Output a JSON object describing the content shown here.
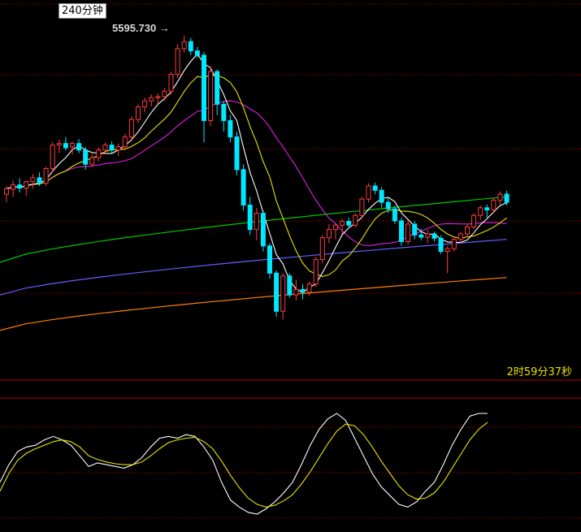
{
  "header": {
    "period_label": "240分钟",
    "peak_price_label": "5595.730",
    "peak_arrow": "→",
    "countdown": "2时59分37秒"
  },
  "colors": {
    "up": "#ff3c3c",
    "down": "#00e8ff",
    "grid": "#b00000",
    "ma5": "#ffffff",
    "ma10": "#e6e600",
    "ma20": "#e020e0",
    "ma60": "#00c800",
    "ma120": "#6060ff",
    "ma250": "#ff8000",
    "k_line": "#ffffff",
    "d_line": "#e6e600"
  },
  "chart_data": [
    {
      "type": "candlestick",
      "title": "",
      "peak": 5595.73,
      "candles": [
        {
          "o": 5305,
          "h": 5320,
          "l": 5290,
          "c": 5315
        },
        {
          "o": 5314,
          "h": 5330,
          "l": 5300,
          "c": 5322
        },
        {
          "o": 5322,
          "h": 5334,
          "l": 5308,
          "c": 5316
        },
        {
          "o": 5316,
          "h": 5330,
          "l": 5302,
          "c": 5328
        },
        {
          "o": 5328,
          "h": 5342,
          "l": 5315,
          "c": 5335
        },
        {
          "o": 5335,
          "h": 5345,
          "l": 5320,
          "c": 5325
        },
        {
          "o": 5325,
          "h": 5355,
          "l": 5320,
          "c": 5352
        },
        {
          "o": 5352,
          "h": 5400,
          "l": 5345,
          "c": 5395
        },
        {
          "o": 5395,
          "h": 5405,
          "l": 5380,
          "c": 5398
        },
        {
          "o": 5398,
          "h": 5410,
          "l": 5385,
          "c": 5390
        },
        {
          "o": 5392,
          "h": 5402,
          "l": 5378,
          "c": 5398
        },
        {
          "o": 5398,
          "h": 5406,
          "l": 5380,
          "c": 5386
        },
        {
          "o": 5386,
          "h": 5392,
          "l": 5350,
          "c": 5360
        },
        {
          "o": 5360,
          "h": 5378,
          "l": 5355,
          "c": 5372
        },
        {
          "o": 5372,
          "h": 5390,
          "l": 5365,
          "c": 5386
        },
        {
          "o": 5386,
          "h": 5400,
          "l": 5378,
          "c": 5395
        },
        {
          "o": 5395,
          "h": 5402,
          "l": 5380,
          "c": 5386
        },
        {
          "o": 5386,
          "h": 5398,
          "l": 5375,
          "c": 5392
        },
        {
          "o": 5392,
          "h": 5416,
          "l": 5386,
          "c": 5410
        },
        {
          "o": 5410,
          "h": 5448,
          "l": 5402,
          "c": 5442
        },
        {
          "o": 5442,
          "h": 5470,
          "l": 5435,
          "c": 5465
        },
        {
          "o": 5465,
          "h": 5482,
          "l": 5455,
          "c": 5476
        },
        {
          "o": 5476,
          "h": 5488,
          "l": 5466,
          "c": 5482
        },
        {
          "o": 5482,
          "h": 5490,
          "l": 5470,
          "c": 5484
        },
        {
          "o": 5484,
          "h": 5500,
          "l": 5476,
          "c": 5494
        },
        {
          "o": 5494,
          "h": 5530,
          "l": 5488,
          "c": 5525
        },
        {
          "o": 5525,
          "h": 5580,
          "l": 5518,
          "c": 5572
        },
        {
          "o": 5572,
          "h": 5596,
          "l": 5565,
          "c": 5585
        },
        {
          "o": 5585,
          "h": 5592,
          "l": 5560,
          "c": 5568
        },
        {
          "o": 5568,
          "h": 5575,
          "l": 5555,
          "c": 5560
        },
        {
          "o": 5560,
          "h": 5566,
          "l": 5400,
          "c": 5440
        },
        {
          "o": 5440,
          "h": 5540,
          "l": 5430,
          "c": 5530
        },
        {
          "o": 5530,
          "h": 5534,
          "l": 5450,
          "c": 5470
        },
        {
          "o": 5470,
          "h": 5476,
          "l": 5420,
          "c": 5440
        },
        {
          "o": 5440,
          "h": 5450,
          "l": 5400,
          "c": 5410
        },
        {
          "o": 5410,
          "h": 5420,
          "l": 5340,
          "c": 5350
        },
        {
          "o": 5350,
          "h": 5360,
          "l": 5275,
          "c": 5285
        },
        {
          "o": 5285,
          "h": 5300,
          "l": 5230,
          "c": 5240
        },
        {
          "o": 5240,
          "h": 5280,
          "l": 5220,
          "c": 5270
        },
        {
          "o": 5270,
          "h": 5275,
          "l": 5200,
          "c": 5210
        },
        {
          "o": 5210,
          "h": 5215,
          "l": 5150,
          "c": 5160
        },
        {
          "o": 5160,
          "h": 5165,
          "l": 5080,
          "c": 5090
        },
        {
          "o": 5090,
          "h": 5160,
          "l": 5075,
          "c": 5155
        },
        {
          "o": 5155,
          "h": 5160,
          "l": 5115,
          "c": 5120
        },
        {
          "o": 5120,
          "h": 5148,
          "l": 5110,
          "c": 5130
        },
        {
          "o": 5130,
          "h": 5140,
          "l": 5112,
          "c": 5125
        },
        {
          "o": 5125,
          "h": 5145,
          "l": 5118,
          "c": 5140
        },
        {
          "o": 5140,
          "h": 5190,
          "l": 5135,
          "c": 5185
        },
        {
          "o": 5185,
          "h": 5230,
          "l": 5178,
          "c": 5225
        },
        {
          "o": 5225,
          "h": 5250,
          "l": 5215,
          "c": 5240
        },
        {
          "o": 5240,
          "h": 5252,
          "l": 5222,
          "c": 5248
        },
        {
          "o": 5248,
          "h": 5260,
          "l": 5232,
          "c": 5255
        },
        {
          "o": 5255,
          "h": 5262,
          "l": 5242,
          "c": 5248
        },
        {
          "o": 5248,
          "h": 5270,
          "l": 5244,
          "c": 5266
        },
        {
          "o": 5266,
          "h": 5300,
          "l": 5260,
          "c": 5296
        },
        {
          "o": 5296,
          "h": 5325,
          "l": 5290,
          "c": 5320
        },
        {
          "o": 5320,
          "h": 5326,
          "l": 5305,
          "c": 5312
        },
        {
          "o": 5312,
          "h": 5318,
          "l": 5280,
          "c": 5290
        },
        {
          "o": 5290,
          "h": 5298,
          "l": 5270,
          "c": 5278
        },
        {
          "o": 5278,
          "h": 5284,
          "l": 5250,
          "c": 5256
        },
        {
          "o": 5256,
          "h": 5262,
          "l": 5210,
          "c": 5218
        },
        {
          "o": 5218,
          "h": 5256,
          "l": 5212,
          "c": 5250
        },
        {
          "o": 5250,
          "h": 5256,
          "l": 5222,
          "c": 5230
        },
        {
          "o": 5230,
          "h": 5242,
          "l": 5220,
          "c": 5226
        },
        {
          "o": 5226,
          "h": 5240,
          "l": 5215,
          "c": 5232
        },
        {
          "o": 5232,
          "h": 5236,
          "l": 5218,
          "c": 5224
        },
        {
          "o": 5224,
          "h": 5230,
          "l": 5195,
          "c": 5200
        },
        {
          "o": 5200,
          "h": 5210,
          "l": 5160,
          "c": 5205
        },
        {
          "o": 5205,
          "h": 5228,
          "l": 5200,
          "c": 5222
        },
        {
          "o": 5222,
          "h": 5236,
          "l": 5215,
          "c": 5232
        },
        {
          "o": 5232,
          "h": 5250,
          "l": 5226,
          "c": 5245
        },
        {
          "o": 5245,
          "h": 5270,
          "l": 5240,
          "c": 5266
        },
        {
          "o": 5266,
          "h": 5284,
          "l": 5258,
          "c": 5280
        },
        {
          "o": 5280,
          "h": 5286,
          "l": 5262,
          "c": 5276
        },
        {
          "o": 5276,
          "h": 5298,
          "l": 5270,
          "c": 5294
        },
        {
          "o": 5294,
          "h": 5310,
          "l": 5286,
          "c": 5305
        },
        {
          "o": 5305,
          "h": 5312,
          "l": 5284,
          "c": 5290
        }
      ],
      "moving_averages": [
        {
          "name": "MA5",
          "color_key": "ma5"
        },
        {
          "name": "MA10",
          "color_key": "ma10"
        },
        {
          "name": "MA20",
          "color_key": "ma20"
        },
        {
          "name": "MA60",
          "color_key": "ma60",
          "values": [
            5180,
            5300
          ]
        },
        {
          "name": "MA120",
          "color_key": "ma120",
          "values": [
            5120,
            5222
          ]
        },
        {
          "name": "MA250",
          "color_key": "ma250",
          "values": [
            5055,
            5152
          ]
        }
      ],
      "ylim": [
        5010,
        5640
      ],
      "grid": true
    },
    {
      "type": "line",
      "title": "",
      "ylim": [
        0,
        100
      ],
      "series": [
        {
          "color_key": "k_line",
          "values": [
            20,
            40,
            55,
            60,
            62,
            68,
            72,
            68,
            62,
            50,
            38,
            42,
            40,
            38,
            36,
            40,
            48,
            60,
            70,
            72,
            70,
            74,
            72,
            60,
            45,
            20,
            0,
            -8,
            -14,
            -16,
            -10,
            -2,
            8,
            20,
            40,
            62,
            80,
            92,
            98,
            90,
            70,
            50,
            30,
            15,
            5,
            -5,
            -8,
            -2,
            10,
            20,
            40,
            62,
            80,
            95,
            98,
            98
          ]
        },
        {
          "color_key": "d_line",
          "values": [
            10,
            30,
            45,
            53,
            58,
            62,
            66,
            68,
            66,
            60,
            50,
            46,
            43,
            41,
            40,
            40,
            43,
            50,
            58,
            65,
            68,
            70,
            71,
            66,
            58,
            44,
            28,
            14,
            2,
            -5,
            -8,
            -6,
            -1,
            6,
            18,
            32,
            48,
            64,
            78,
            86,
            84,
            74,
            60,
            44,
            30,
            16,
            6,
            1,
            2,
            8,
            20,
            36,
            52,
            68,
            80,
            88
          ]
        }
      ],
      "grid": true
    }
  ]
}
